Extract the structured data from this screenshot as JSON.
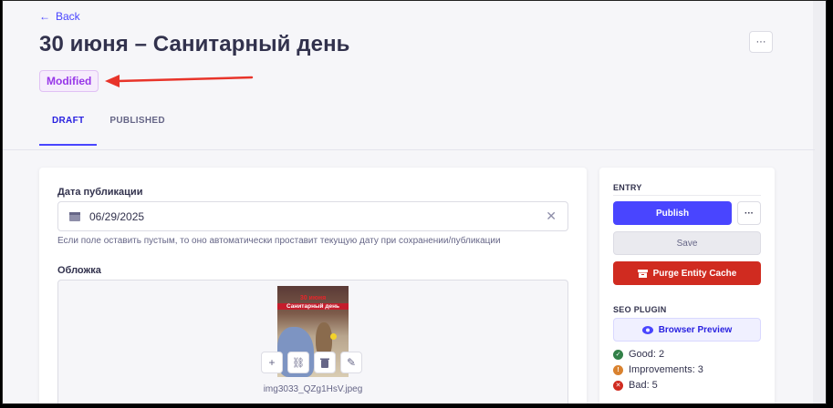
{
  "header": {
    "back_label": "Back",
    "title": "30 июня – Санитарный день",
    "more_label": "···",
    "status_badge": "Modified"
  },
  "tabs": [
    {
      "label": "DRAFT",
      "active": true
    },
    {
      "label": "PUBLISHED",
      "active": false
    }
  ],
  "main": {
    "date_field": {
      "label": "Дата публикации",
      "value": "06/29/2025",
      "clear_symbol": "✕",
      "hint": "Если поле оставить пустым, то оно автоматически проставит текущую дату при сохранении/публикации"
    },
    "cover": {
      "label": "Обложка",
      "thumbnail_text_line1": "30 июня",
      "thumbnail_text_line2": "Санитарный день",
      "file_name": "img3033_QZg1HsV.jpeg",
      "tools": [
        {
          "icon": "plus-icon",
          "glyph": "+"
        },
        {
          "icon": "link-icon",
          "glyph": "🔗"
        },
        {
          "icon": "trash-icon",
          "glyph": "🗑"
        },
        {
          "icon": "pencil-icon",
          "glyph": "✎"
        }
      ]
    }
  },
  "sidebar": {
    "entry_heading": "ENTRY",
    "publish_label": "Publish",
    "more_label": "···",
    "save_label": "Save",
    "purge_label": "Purge Entity Cache",
    "seo_heading": "SEO PLUGIN",
    "preview_label": "Browser Preview",
    "seo_results": [
      {
        "label": "Good: 2",
        "status": "good",
        "glyph": "✓"
      },
      {
        "label": "Improvements: 3",
        "status": "improve",
        "glyph": "!"
      },
      {
        "label": "Bad: 5",
        "status": "bad",
        "glyph": "✕"
      }
    ]
  },
  "colors": {
    "primary": "#4945ff",
    "danger": "#d02b20",
    "badge_text": "#9736e8",
    "annotation_arrow": "#e8342a"
  }
}
